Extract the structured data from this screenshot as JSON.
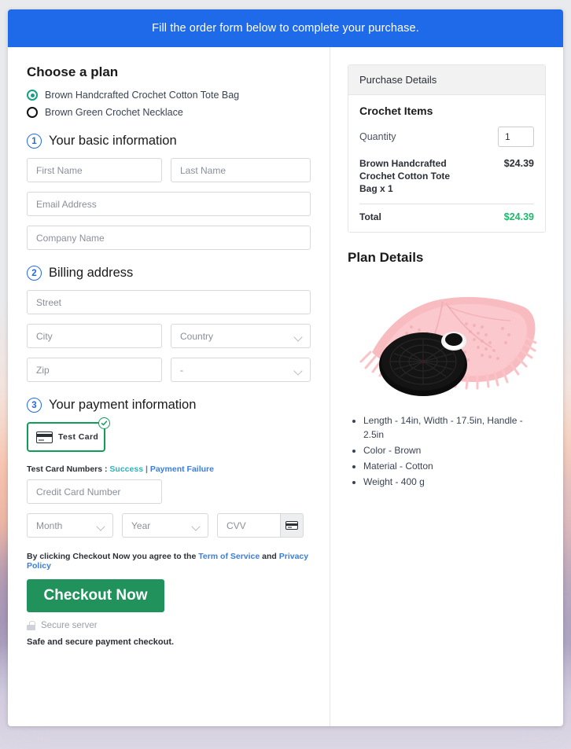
{
  "banner": {
    "text": "Fill the order form below to complete your purchase."
  },
  "plan": {
    "title": "Choose a plan",
    "options": [
      {
        "label": "Brown Handcrafted Crochet Cotton Tote Bag",
        "selected": true
      },
      {
        "label": "Brown Green Crochet Necklace",
        "selected": false
      }
    ]
  },
  "steps": {
    "basic": {
      "num": "1",
      "label": "Your basic information"
    },
    "billing": {
      "num": "2",
      "label": "Billing address"
    },
    "payment": {
      "num": "3",
      "label": "Your payment information"
    }
  },
  "fields": {
    "first_name": "First Name",
    "last_name": "Last Name",
    "email": "Email Address",
    "company": "Company Name",
    "street": "Street",
    "city": "City",
    "country": "Country",
    "zip": "Zip",
    "state": "-",
    "credit_card": "Credit Card Number",
    "month": "Month",
    "year": "Year",
    "cvv": "CVV"
  },
  "payment": {
    "tile_label": "Test  Card",
    "test_numbers_label": "Test Card Numbers :",
    "success_link": "Success",
    "separator": "|",
    "failure_link": "Payment Failure",
    "agree_prefix": "By clicking Checkout Now you agree to the",
    "terms_link": "Term of Service",
    "agree_and": "and",
    "privacy_link": "Privacy Policy",
    "checkout_label": "Checkout Now",
    "secure_server": "Secure server",
    "safe_text": "Safe and secure payment checkout."
  },
  "purchase": {
    "header": "Purchase Details",
    "items_title": "Crochet Items",
    "quantity_label": "Quantity",
    "quantity_value": "1",
    "line_item_name": "Brown Handcrafted Crochet Cotton Tote Bag x 1",
    "line_item_price": "$24.39",
    "total_label": "Total",
    "total_value": "$24.39"
  },
  "plan_details": {
    "title": "Plan Details",
    "bullets": [
      "Length - 14in, Width - 17.5in, Handle - 2.5in",
      "Color - Brown",
      "Material - Cotton",
      "Weight - 400 g"
    ]
  },
  "colors": {
    "banner_blue": "#1f6ae8",
    "accent_blue": "#3b7ddd",
    "green_button": "#21925b",
    "green_selected": "#0f9d58",
    "total_green": "#1bb96a",
    "success_teal": "#2ab3c0"
  }
}
